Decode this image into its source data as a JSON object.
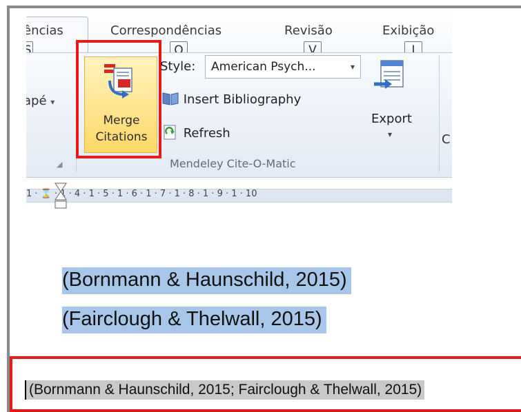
{
  "ribbon": {
    "tabs": [
      {
        "label": "ências",
        "keytip": "S"
      },
      {
        "label": "Correspondências",
        "keytip": "O"
      },
      {
        "label": "Revisão",
        "keytip": "V"
      },
      {
        "label": "Exibição",
        "keytip": "J"
      }
    ],
    "left_group": {
      "label": "apé",
      "arrow": "▾"
    },
    "merge_citations": {
      "line1": "Merge",
      "line2": "Citations"
    },
    "style": {
      "label": "Style:",
      "value": "American Psych...",
      "arrow": "▾"
    },
    "insert_bibliography": "Insert Bibliography",
    "refresh": "Refresh",
    "group_label": "Mendeley Cite-O-Matic",
    "export": {
      "label": "Export",
      "arrow": "▾"
    },
    "next_group_partial": "C"
  },
  "ruler": {
    "numbers": "1 · ⌛ · 1 · 4 · 1 · 5 · 1 · 6 · 1 · 7 · 1 · 8 · 1 · 9 · 1 · 10"
  },
  "document": {
    "citations": [
      "(Bornmann & Haunschild, 2015)",
      "(Fairclough & Thelwall, 2015)"
    ],
    "merged_citation": "(Bornmann & Haunschild, 2015; Fairclough & Thelwall, 2015)"
  },
  "colors": {
    "highlight_box": "#e31b1b",
    "selection": "#a8c6ea",
    "merge_button": "#ffd867"
  }
}
